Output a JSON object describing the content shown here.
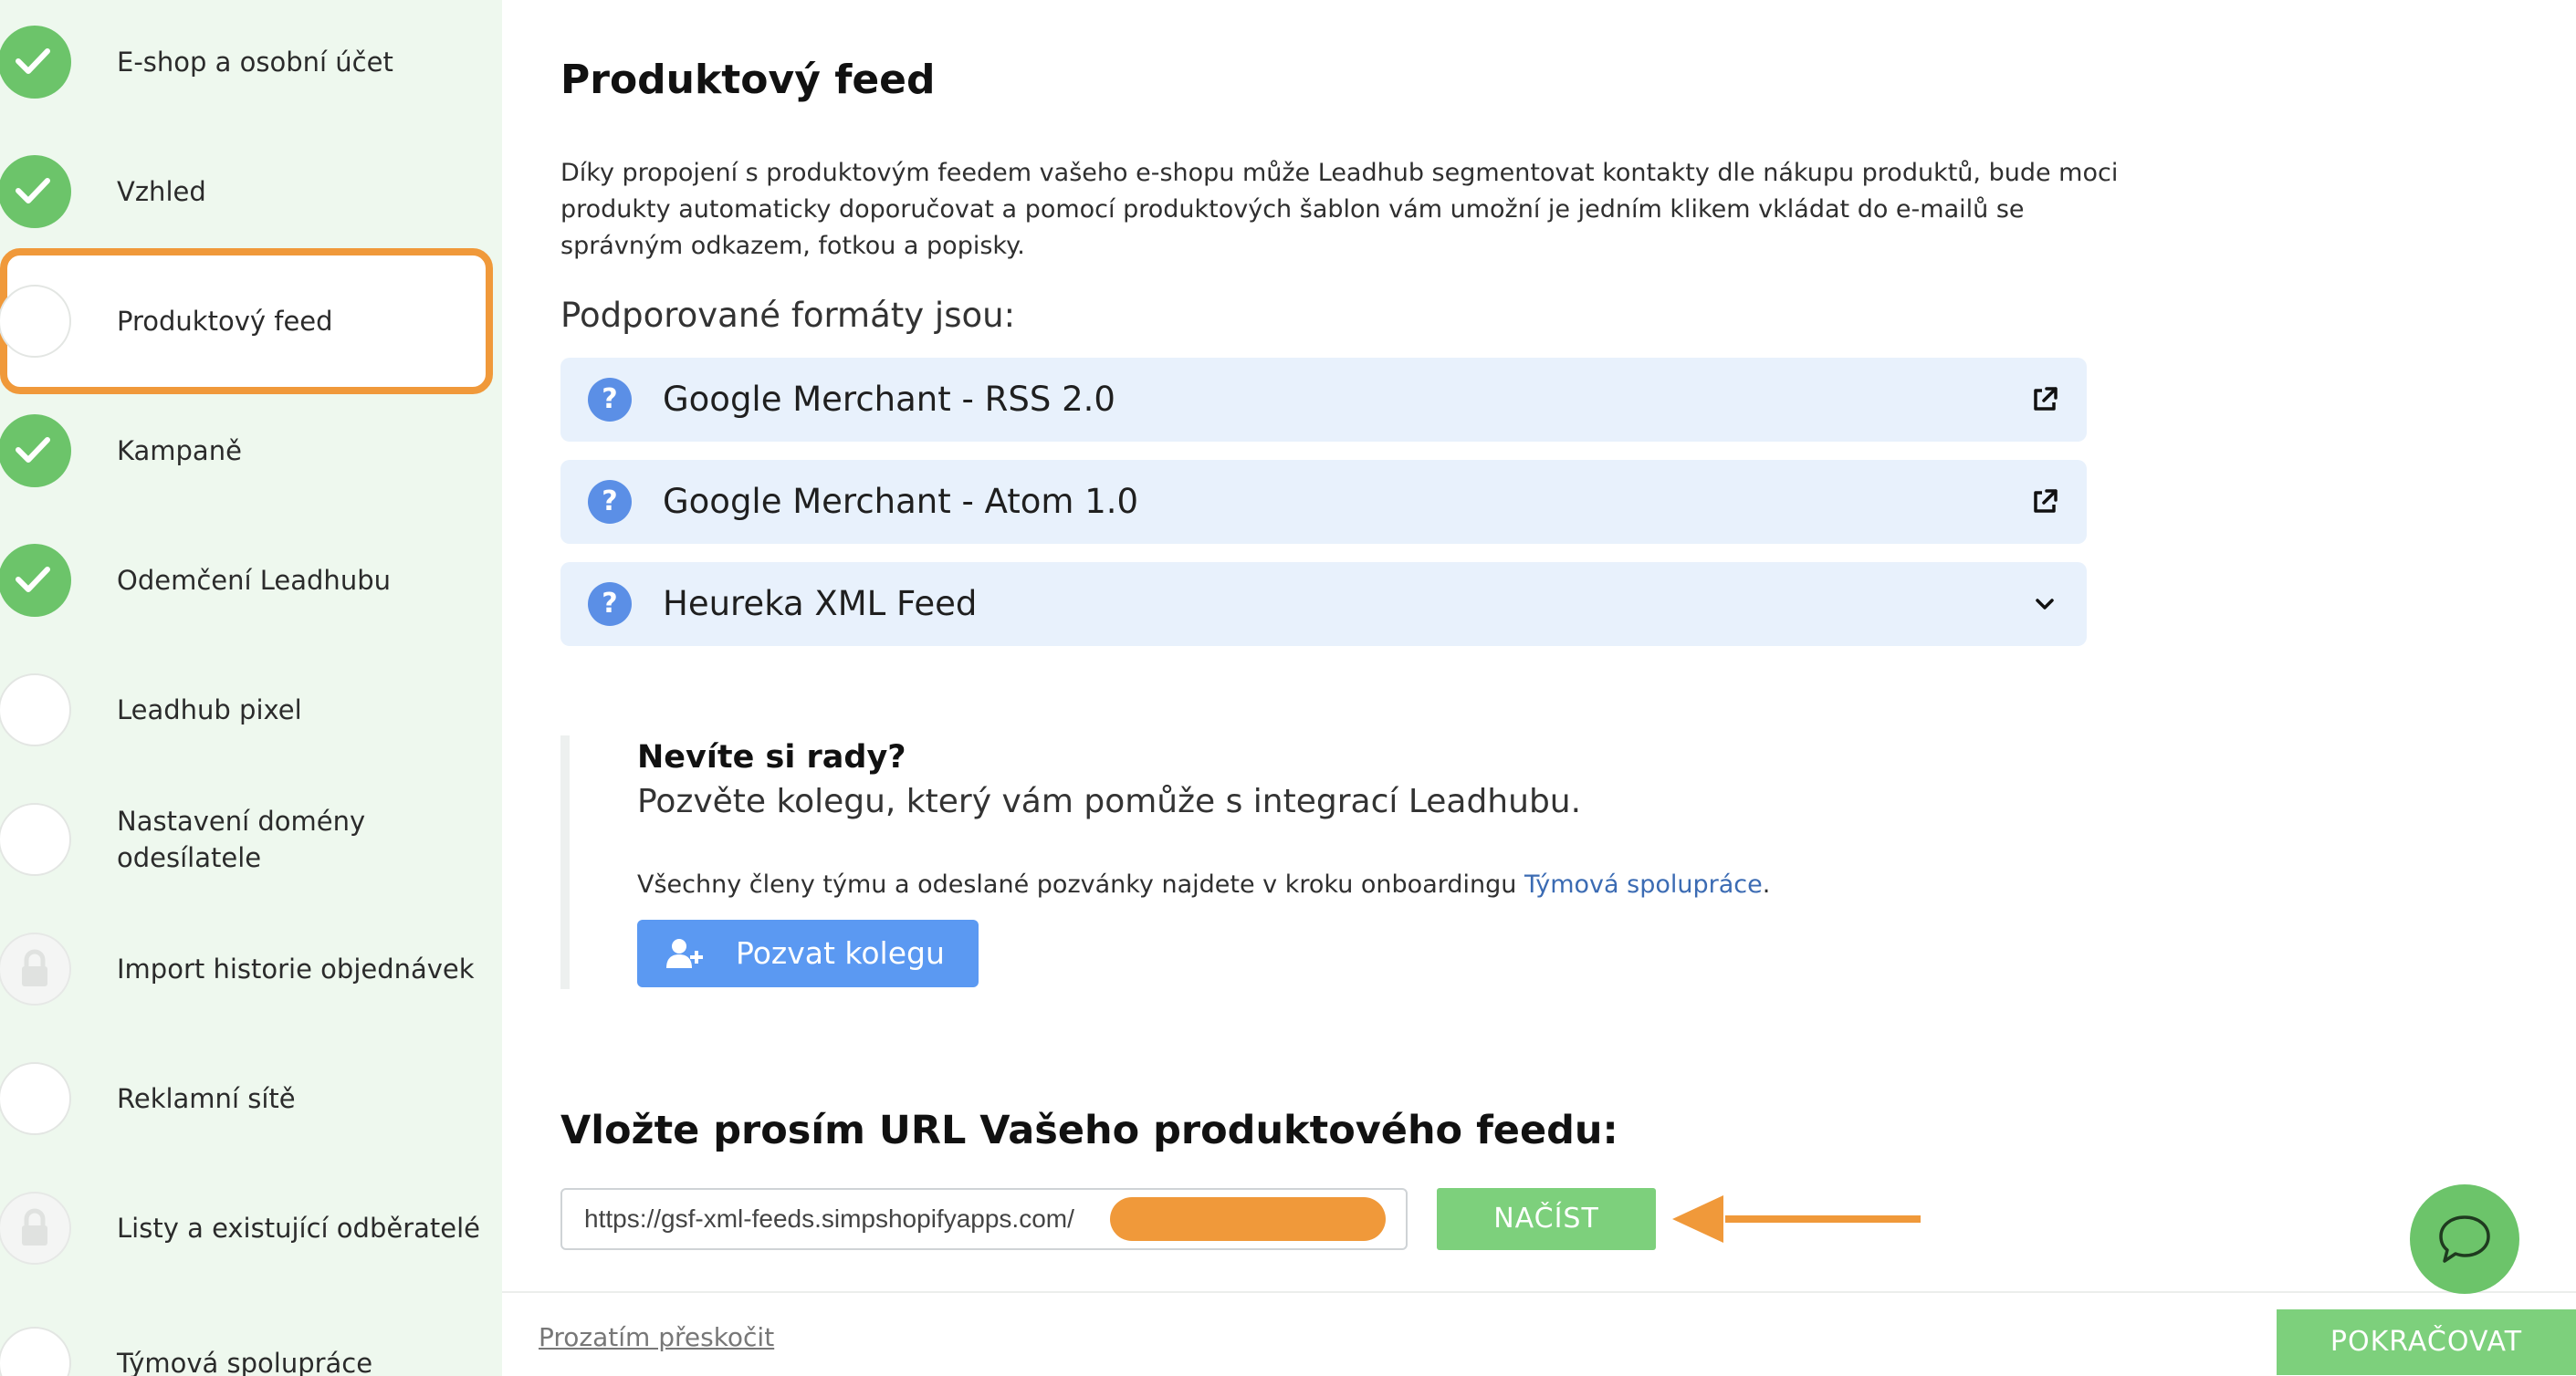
{
  "sidebar": {
    "steps": [
      {
        "label": "E-shop a osobní účet",
        "status": "done"
      },
      {
        "label": "Vzhled",
        "status": "done"
      },
      {
        "label": "Produktový feed",
        "status": "current"
      },
      {
        "label": "Kampaně",
        "status": "done"
      },
      {
        "label": "Odemčení Leadhubu",
        "status": "done"
      },
      {
        "label": "Leadhub pixel",
        "status": "todo"
      },
      {
        "label": "Nastavení domény odesílatele",
        "status": "todo"
      },
      {
        "label": "Import historie objednávek",
        "status": "locked"
      },
      {
        "label": "Reklamní sítě",
        "status": "todo"
      },
      {
        "label": "Listy a existující odběratelé",
        "status": "locked"
      },
      {
        "label": "Týmová spolupráce",
        "status": "todo"
      }
    ]
  },
  "main": {
    "title": "Produktový feed",
    "intro": "Díky propojení s produktovým feedem vašeho e-shopu může Leadhub segmentovat kontakty dle nákupu produktů, bude moci produkty automaticky doporučovat a pomocí produktových šablon vám umožní je jedním klikem vkládat do e-mailů se správným odkazem, fotkou a popisky.",
    "formats_title": "Podporované formáty jsou:",
    "formats": [
      {
        "label": "Google Merchant - RSS 2.0",
        "icon": "external-link-icon"
      },
      {
        "label": "Google Merchant - Atom 1.0",
        "icon": "external-link-icon"
      },
      {
        "label": "Heureka XML Feed",
        "icon": "chevron-down-icon"
      }
    ],
    "help": {
      "title": "Nevíte si rady?",
      "subtitle": "Pozvěte kolegu, který vám pomůže s integrací Leadhubu.",
      "text": "Všechny členy týmu a odeslané pozvánky najdete v kroku onboardingu ",
      "link": "Týmová spolupráce",
      "text_end": ".",
      "button": "Pozvat kolegu"
    },
    "url_title": "Vložte prosím URL Vašeho produktového feedu:",
    "url_value": "https://gsf-xml-feeds.simpshopifyapps.com/",
    "load_button": "NAČÍST"
  },
  "footer": {
    "skip": "Prozatím přeskočit",
    "continue": "POKRAČOVAT"
  },
  "colors": {
    "sidebar_bg": "#eef8ee",
    "done_green": "#6cc46a",
    "button_green": "#7dd07c",
    "accent_blue": "#5b99f2",
    "highlight_orange": "#f0993a",
    "accordion_bg": "#e8f1fc"
  }
}
